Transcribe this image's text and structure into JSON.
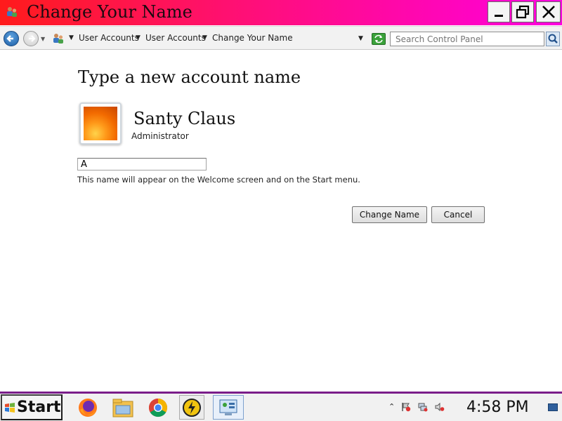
{
  "window": {
    "title": "Change Your Name",
    "controls": [
      "minimize-icon",
      "restore-icon",
      "close-icon"
    ]
  },
  "addressbar": {
    "breadcrumbs": [
      "User Accounts",
      "User Accounts",
      "Change Your Name"
    ],
    "search_placeholder": "Search Control Panel"
  },
  "main": {
    "heading": "Type a new account name",
    "user_name": "Santy Claus",
    "account_type": "Administrator",
    "name_input_value": "A",
    "hint": "This name will appear on the Welcome screen and on the Start menu.",
    "buttons": {
      "change_name": "Change Name",
      "cancel": "Cancel"
    }
  },
  "taskbar": {
    "start_label": "Start",
    "apps": [
      "firefox-icon",
      "file-explorer-icon",
      "chrome-icon",
      "power-icon",
      "control-panel-icon"
    ],
    "clock": "4:58 PM"
  },
  "colors": {
    "titlebar_start": "#ff1b1b",
    "titlebar_end": "#ff00e0",
    "taskbar_border": "#7a1d8a"
  }
}
